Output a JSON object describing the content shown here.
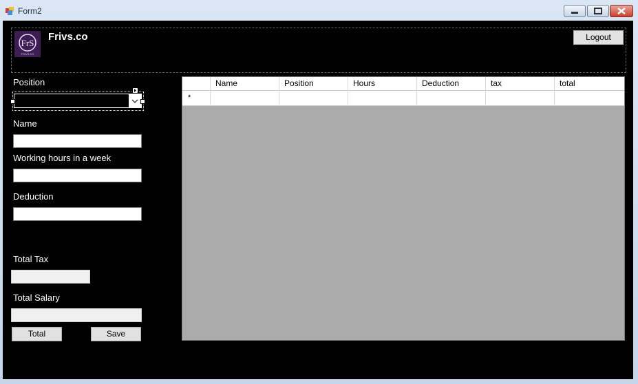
{
  "window": {
    "title": "Form2"
  },
  "header": {
    "brand": "Frivs.co",
    "logo_text": "FrS",
    "logo_caption": "FRIVS.CO",
    "logout_label": "Logout"
  },
  "form": {
    "position_label": "Position",
    "position_value": "",
    "name_label": "Name",
    "name_value": "",
    "hours_label": "Working hours in a week",
    "hours_value": "",
    "deduction_label": "Deduction",
    "deduction_value": "",
    "total_tax_label": "Total Tax",
    "total_tax_value": "",
    "total_salary_label": "Total Salary",
    "total_salary_value": "",
    "total_button": "Total",
    "save_button": "Save"
  },
  "grid": {
    "columns": [
      "Name",
      "Position",
      "Hours",
      "Deduction",
      "tax",
      "total"
    ],
    "new_row_marker": "*"
  },
  "colors": {
    "background": "#000000",
    "grid_background": "#ababab",
    "logo_bg": "#3e1c55"
  },
  "icons": [
    "app-form-icon",
    "minimize-icon",
    "maximize-icon",
    "close-icon",
    "chevron-down-icon",
    "smart-tag-icon"
  ]
}
